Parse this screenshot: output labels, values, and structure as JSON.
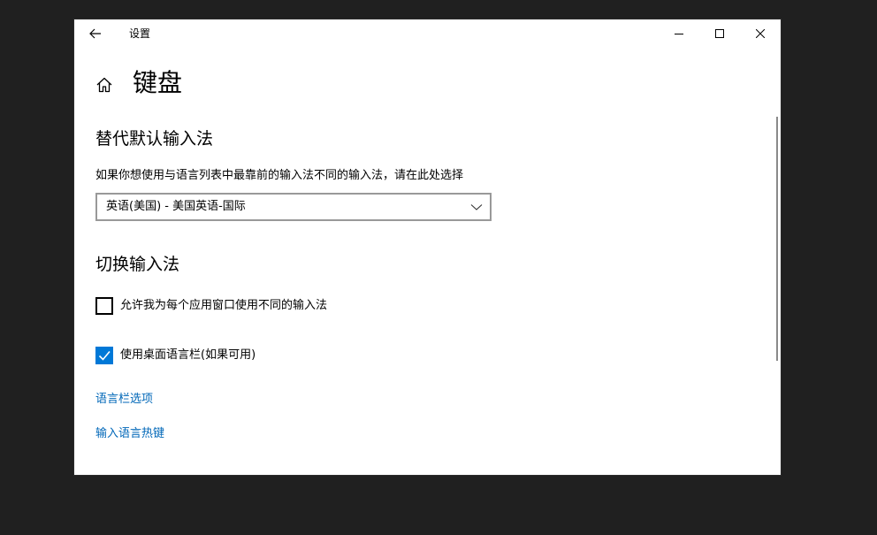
{
  "window": {
    "title": "设置"
  },
  "page": {
    "title": "键盘"
  },
  "override": {
    "heading": "替代默认输入法",
    "description": "如果你想使用与语言列表中最靠前的输入法不同的输入法，请在此处选择",
    "selected": "英语(美国) - 美国英语-国际"
  },
  "switch": {
    "heading": "切换输入法",
    "checkboxes": [
      {
        "label": "允许我为每个应用窗口使用不同的输入法",
        "checked": false
      },
      {
        "label": "使用桌面语言栏(如果可用)",
        "checked": true
      }
    ]
  },
  "links": [
    "语言栏选项",
    "输入语言热键"
  ],
  "colors": {
    "accent": "#0078d7",
    "link": "#0067b8",
    "desktop": "#202020"
  },
  "icons": [
    "back-arrow-icon",
    "minimize-icon",
    "maximize-icon",
    "close-icon",
    "home-icon",
    "chevron-down-icon",
    "checkmark-icon"
  ]
}
